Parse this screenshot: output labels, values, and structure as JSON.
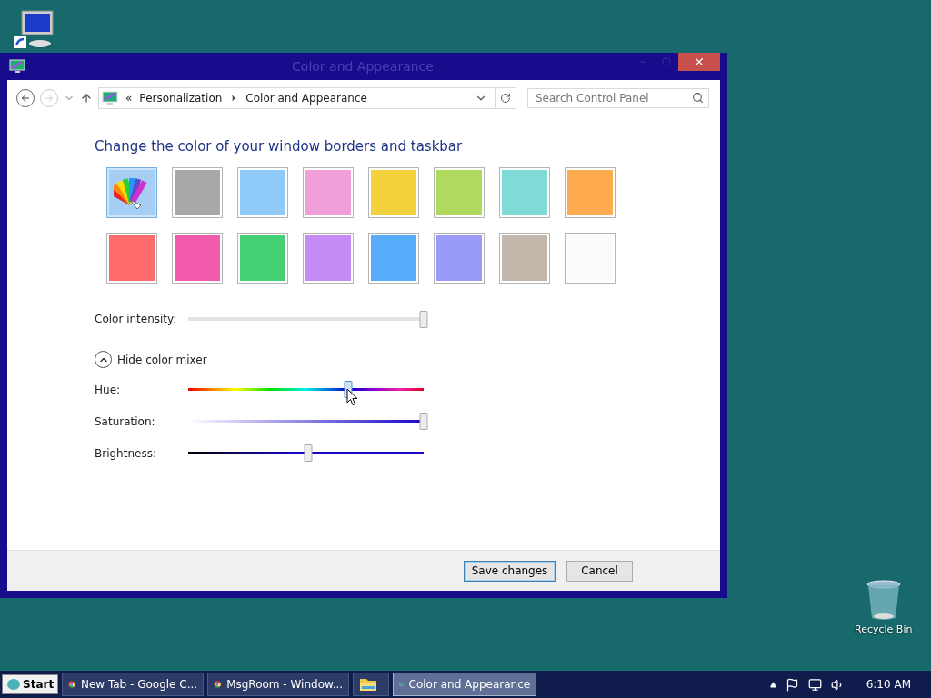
{
  "desktop_icons": [
    {
      "kind": "computer"
    },
    {
      "kind": "recycle",
      "label": "Recycle Bin"
    }
  ],
  "window": {
    "title": "Color and Appearance"
  },
  "address_bar": {
    "overflow": "«",
    "crumbs": [
      "Personalization",
      "Color and Appearance"
    ]
  },
  "search": {
    "placeholder": "Search Control Panel"
  },
  "heading": "Change the color of your window borders and taskbar",
  "swatches": [
    {
      "kind": "custom",
      "color": "#a6cdf4",
      "selected": true
    },
    {
      "kind": "color",
      "color": "#a8a8a8",
      "selected": false
    },
    {
      "kind": "color",
      "color": "#8fcaf9",
      "selected": false
    },
    {
      "kind": "color",
      "color": "#f19fd9",
      "selected": false
    },
    {
      "kind": "color",
      "color": "#f3d23d",
      "selected": false
    },
    {
      "kind": "color",
      "color": "#b0da5e",
      "selected": false
    },
    {
      "kind": "color",
      "color": "#7fdbd6",
      "selected": false
    },
    {
      "kind": "color",
      "color": "#ffab4f",
      "selected": false
    },
    {
      "kind": "color",
      "color": "#ff6c6c",
      "selected": false
    },
    {
      "kind": "color",
      "color": "#f25aae",
      "selected": false
    },
    {
      "kind": "color",
      "color": "#45cf74",
      "selected": false
    },
    {
      "kind": "color",
      "color": "#c58cf6",
      "selected": false
    },
    {
      "kind": "color",
      "color": "#56acf9",
      "selected": false
    },
    {
      "kind": "color",
      "color": "#9a9bf9",
      "selected": false
    },
    {
      "kind": "color",
      "color": "#c3b6aa",
      "selected": false
    },
    {
      "kind": "color",
      "color": "#fbfbfb",
      "selected": false
    }
  ],
  "intensity": {
    "label": "Color intensity:",
    "level": 1.0
  },
  "mixer_toggle": {
    "label": "Hide color mixer",
    "expanded": true
  },
  "mixer": [
    {
      "kind": "hue",
      "label": "Hue:",
      "level": 0.68
    },
    {
      "kind": "saturation",
      "label": "Saturation:",
      "level": 1.0
    },
    {
      "kind": "brightness",
      "label": "Brightness:",
      "level": 0.51
    }
  ],
  "buttons": [
    {
      "label": "Save changes",
      "default": true
    },
    {
      "label": "Cancel",
      "default": false
    }
  ],
  "taskbar": {
    "start": "Start",
    "items": [
      {
        "kind": "browser",
        "label": "New Tab - Google C...",
        "selected": false
      },
      {
        "kind": "browser",
        "label": "MsgRoom - Window...",
        "selected": false
      },
      {
        "kind": "folder",
        "selected": false
      },
      {
        "kind": "control",
        "label": "Color and Appearance",
        "selected": true
      }
    ],
    "clock": "6:10 AM"
  }
}
